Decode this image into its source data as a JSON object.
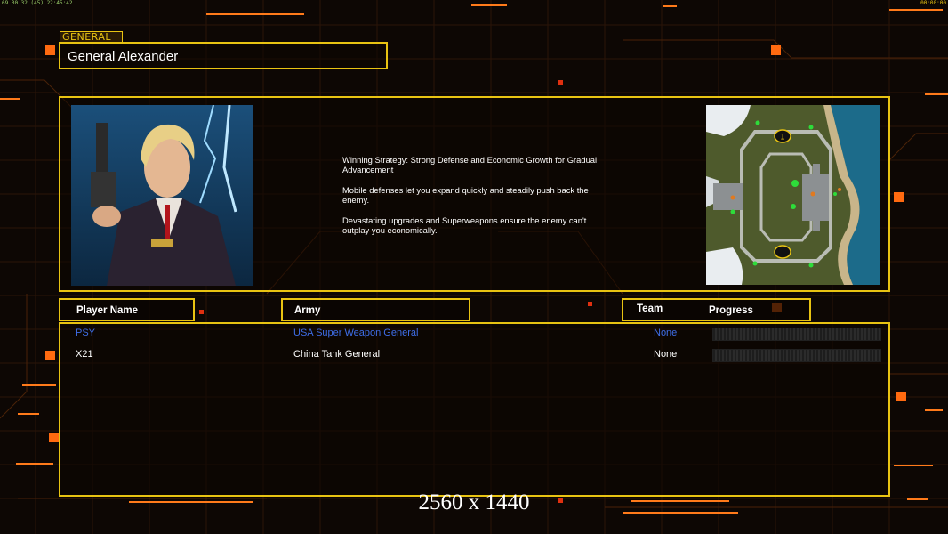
{
  "hud": {
    "left": "69 30 32 (45) 22:45:42",
    "right": "00:00:00"
  },
  "general": {
    "tag": "GENERAL",
    "name": "General Alexander",
    "description": [
      "Winning Strategy: Strong Defense and Economic Growth for Gradual\n Advancement",
      "Mobile defenses let you expand quickly and steadily push back the\n enemy.",
      "Devastating upgrades and Superweapons ensure the enemy can't\n outplay you economically."
    ]
  },
  "minimap": {
    "marker_label": "1"
  },
  "table": {
    "headers": {
      "player": "Player Name",
      "army": "Army",
      "team": "Team",
      "progress": "Progress"
    },
    "rows": [
      {
        "player": "PSY",
        "army": "USA Super Weapon General",
        "team": "None",
        "color": "#3f6ee8",
        "progress": 0
      },
      {
        "player": "X21",
        "army": "China Tank General",
        "team": "None",
        "color": "#ffffff",
        "progress": 0
      }
    ]
  },
  "resolution_label": "2560 x 1440",
  "colors": {
    "accent": "#e8c312",
    "orange": "#ff6a10",
    "background": "#0d0704"
  }
}
